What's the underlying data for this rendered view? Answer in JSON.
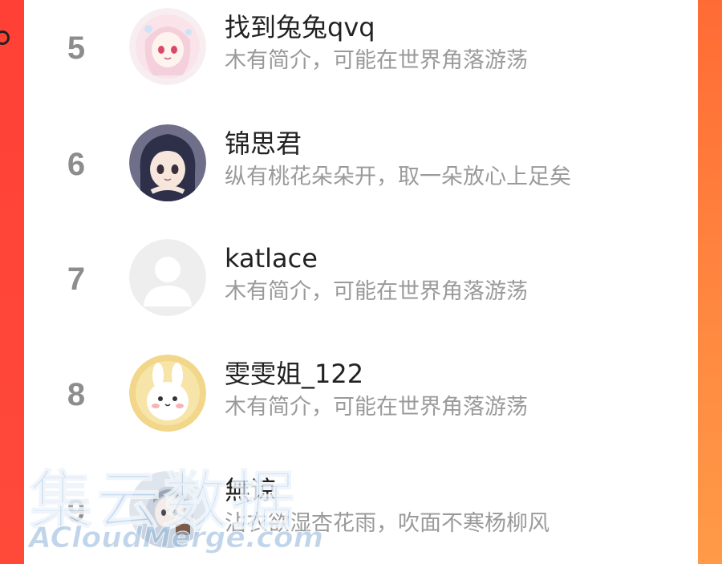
{
  "list": {
    "items": [
      {
        "rank": "5",
        "name": "找到兔兔qvq",
        "bio": "木有简介，可能在世界角落游荡",
        "avatar": "anime-girl-pink-avatar"
      },
      {
        "rank": "6",
        "name": "锦思君",
        "bio": "纵有桃花朵朵开，取一朵放心上足矣",
        "avatar": "anime-girl-dark-hair-avatar"
      },
      {
        "rank": "7",
        "name": "katlace",
        "bio": "木有简介，可能在世界角落游荡",
        "avatar": "default-person-avatar"
      },
      {
        "rank": "8",
        "name": "雯雯姐_122",
        "bio": "木有简介，可能在世界角落游荡",
        "avatar": "bunny-avatar"
      },
      {
        "rank": "9",
        "name": "無谅",
        "bio": "沾衣欲湿杏花雨，吹面不寒杨柳风",
        "avatar": "anime-character-avatar"
      }
    ]
  },
  "watermark": {
    "cn": "集云数据",
    "en": "ACloudMerge.com"
  },
  "colors": {
    "background_top": "#ff4a3c",
    "background_bottom": "#ff8f45",
    "rank_gray": "#8d8d8d",
    "name_dark": "#222222",
    "bio_gray": "#9a9a9a"
  }
}
